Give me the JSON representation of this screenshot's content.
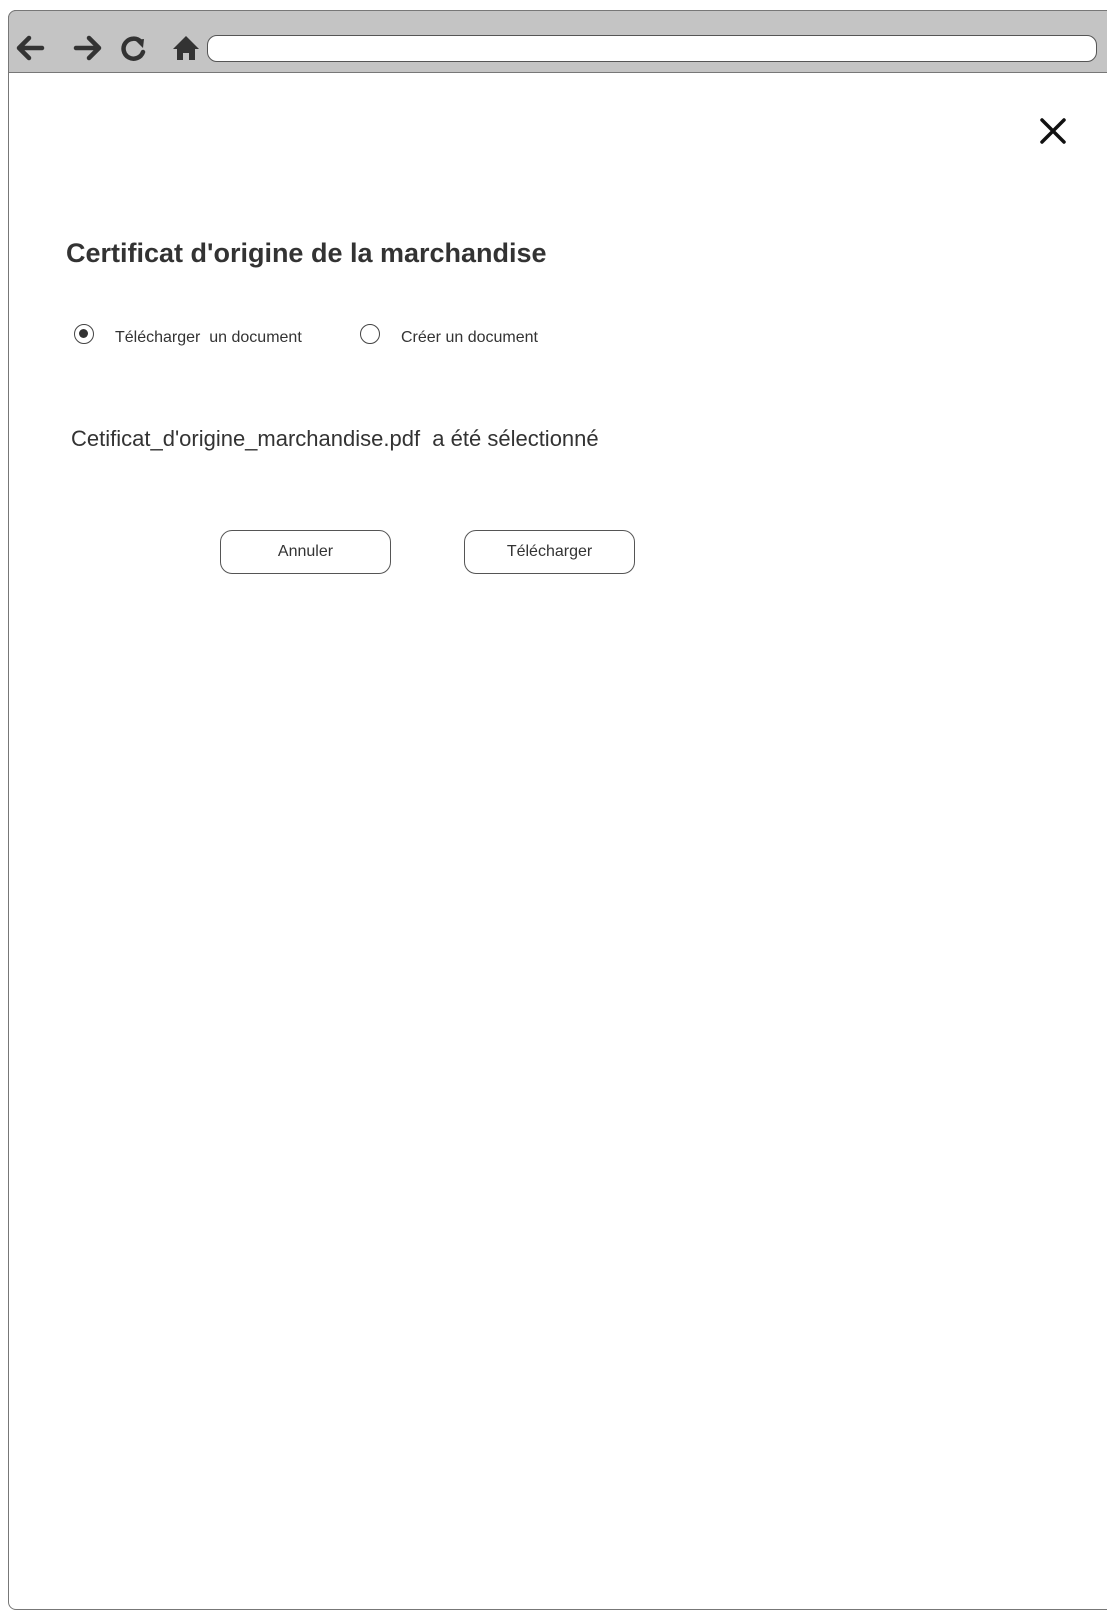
{
  "browser": {
    "url": "",
    "nav_icons": [
      "back-arrow-icon",
      "forward-arrow-icon",
      "reload-icon",
      "home-icon"
    ]
  },
  "dialog": {
    "close_icon": "close-icon",
    "title": "Certificat d'origine de la marchandise",
    "options": [
      {
        "label": "Télécharger  un document",
        "selected": true
      },
      {
        "label": "Créer un document",
        "selected": false
      }
    ],
    "status_message": "Cetificat_d'origine_marchandise.pdf  a été sélectionné",
    "cancel_label": "Annuler",
    "upload_label": "Télécharger"
  },
  "colors": {
    "toolbar": "#c4c4c4",
    "border": "#777777",
    "text": "#333333"
  }
}
